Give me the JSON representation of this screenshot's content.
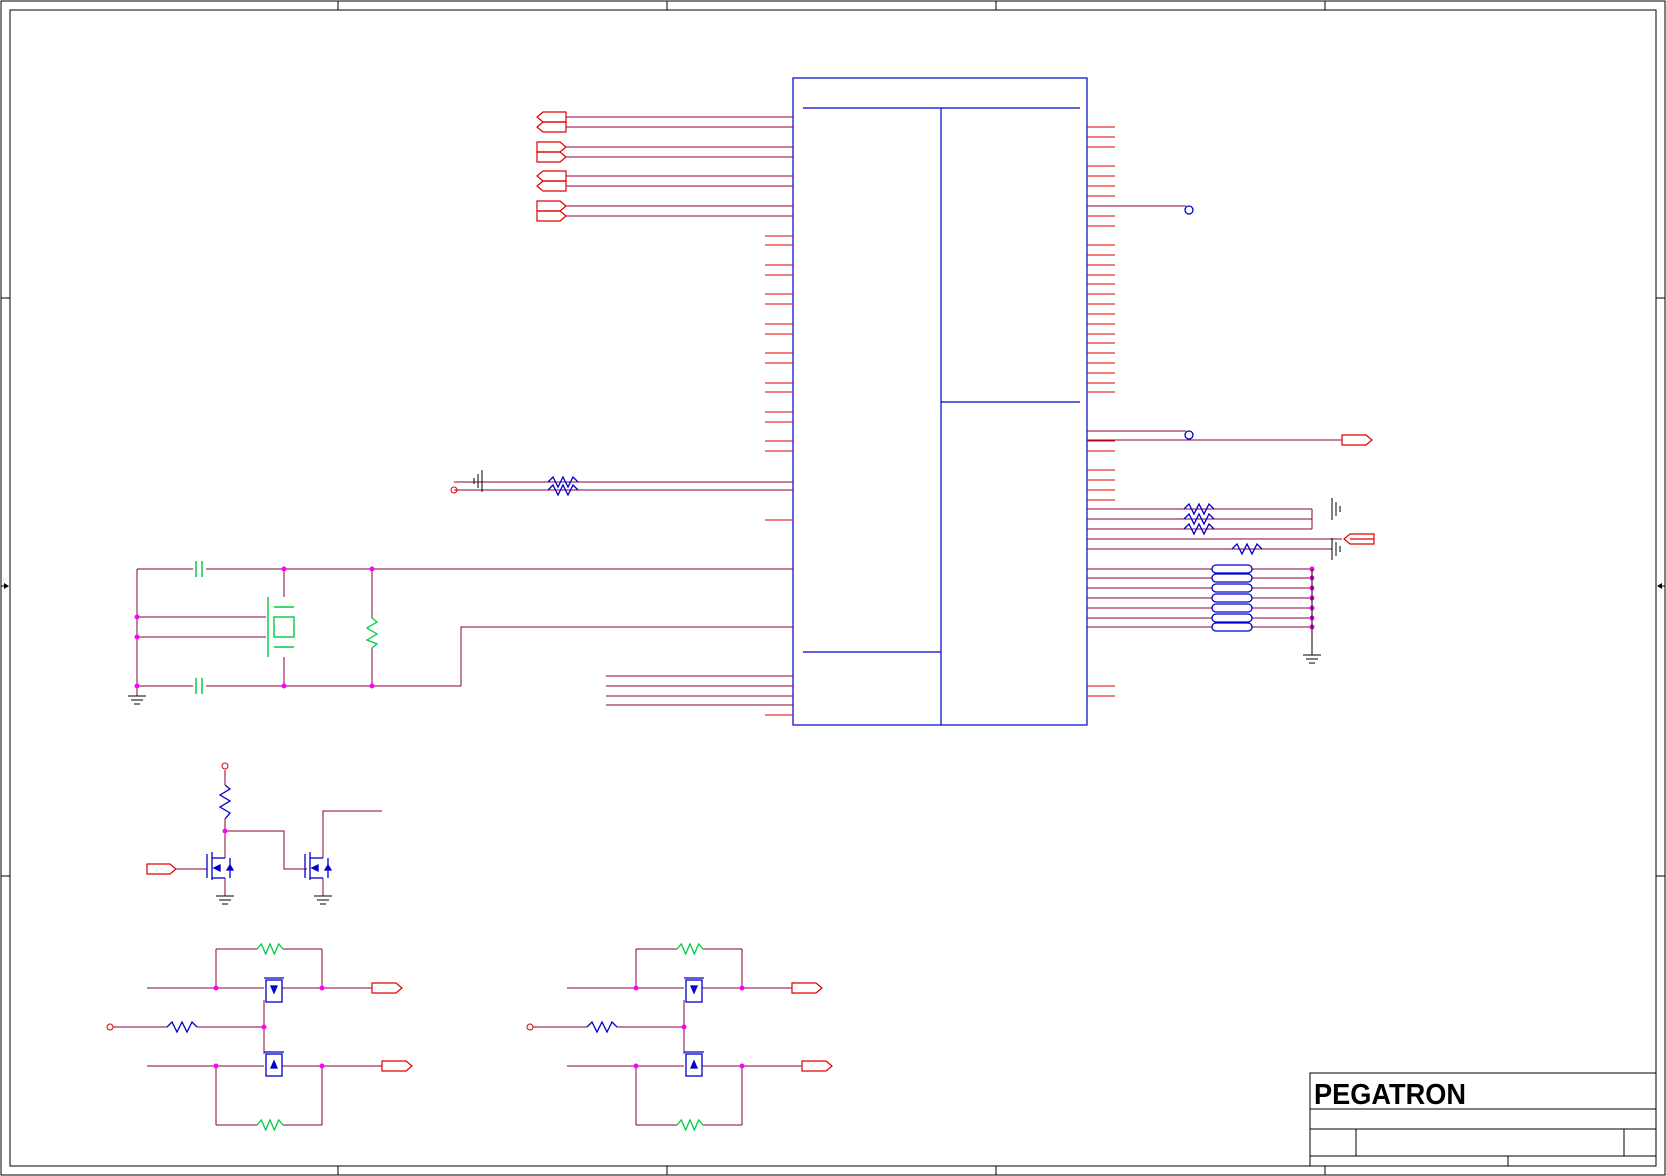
{
  "title_block": {
    "company_logo": "PEGATRON",
    "title": "",
    "size": "",
    "document_number": "",
    "revision": "",
    "date": "",
    "sheet": ""
  },
  "colors": {
    "border": "#000000",
    "wire": "#8B0033",
    "pin": "#E00000",
    "component": "#0000CC",
    "passive": "#00CC44",
    "junction": "#FF00FF",
    "background": "#FFFFFF"
  },
  "components": [
    {
      "kind": "ic",
      "name": "main-ic-u1"
    },
    {
      "kind": "crystal",
      "name": "crystal-y1"
    },
    {
      "kind": "resistor",
      "name": "crystal-feedback-resistor"
    },
    {
      "kind": "capacitor",
      "name": "crystal-load-capacitor"
    },
    {
      "kind": "mosfet",
      "name": "level-shift-mosfet"
    },
    {
      "kind": "ferrite",
      "name": "ferrite-bead-array"
    }
  ]
}
